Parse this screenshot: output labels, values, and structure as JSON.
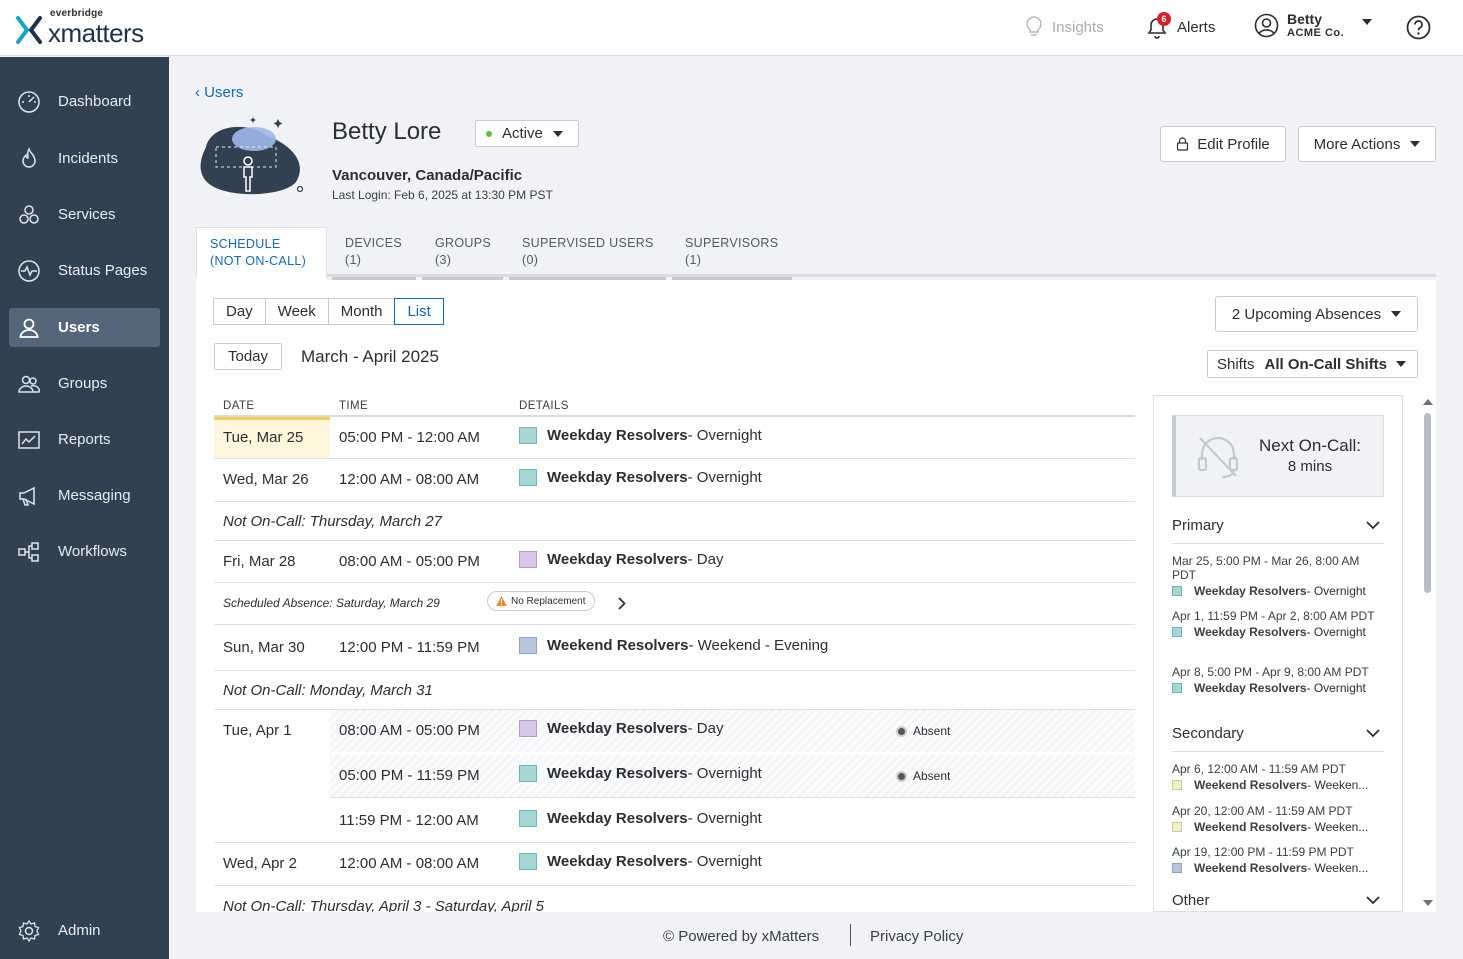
{
  "header": {
    "brand_sub": "everbridge",
    "brand_main": "xmatters",
    "insights": "Insights",
    "alerts": "Alerts",
    "alerts_count": "6",
    "user_name": "Betty",
    "user_org": "ACME Co."
  },
  "sidebar": {
    "items": [
      {
        "label": "Dashboard",
        "icon": "gauge-icon"
      },
      {
        "label": "Incidents",
        "icon": "flame-icon"
      },
      {
        "label": "Services",
        "icon": "services-icon"
      },
      {
        "label": "Status Pages",
        "icon": "pulse-icon"
      },
      {
        "label": "Users",
        "icon": "user-icon"
      },
      {
        "label": "Groups",
        "icon": "groups-icon"
      },
      {
        "label": "Reports",
        "icon": "chart-icon"
      },
      {
        "label": "Messaging",
        "icon": "megaphone-icon"
      },
      {
        "label": "Workflows",
        "icon": "workflow-icon"
      }
    ],
    "admin": "Admin",
    "collapse": "«"
  },
  "profile": {
    "back": "‹ Users",
    "name": "Betty Lore",
    "status": "Active",
    "location": "Vancouver, Canada/Pacific",
    "last_login": "Last Login: Feb 6, 2025 at 13:30 PM PST",
    "edit": "Edit Profile",
    "more": "More Actions"
  },
  "tabs": [
    {
      "l1": "SCHEDULE",
      "l2": "(NOT ON-CALL)"
    },
    {
      "l1": "DEVICES",
      "l2": "(1)"
    },
    {
      "l1": "GROUPS",
      "l2": "(3)"
    },
    {
      "l1": "SUPERVISED USERS",
      "l2": "(0)"
    },
    {
      "l1": "SUPERVISORS",
      "l2": "(1)"
    }
  ],
  "schedule": {
    "views": [
      "Day",
      "Week",
      "Month",
      "List"
    ],
    "absences": "2 Upcoming Absences",
    "today": "Today",
    "range": "March - April 2025",
    "shifts_label": "Shifts",
    "shifts_value": "All On-Call Shifts",
    "col_date": "DATE",
    "col_time": "TIME",
    "col_details": "DETAILS",
    "rows": {
      "r1": {
        "date": "Tue, Mar 25",
        "time": "05:00 PM - 12:00 AM",
        "group": "Weekday Resolvers",
        "shift": " - Overnight"
      },
      "r2": {
        "date": "Wed, Mar 26",
        "time": "12:00 AM - 08:00 AM",
        "group": "Weekday Resolvers",
        "shift": " - Overnight"
      },
      "n1": "Not On-Call: Thursday, March 27",
      "r3": {
        "date": "Fri, Mar 28",
        "time": "08:00 AM - 05:00 PM",
        "group": "Weekday Resolvers",
        "shift": " - Day"
      },
      "abs": "Scheduled Absence: Saturday, March 29",
      "norepl": "No Replacement",
      "r4": {
        "date": "Sun, Mar 30",
        "time": "12:00 PM - 11:59 PM",
        "group": "Weekend Resolvers",
        "shift": " - Weekend - Evening"
      },
      "n2": "Not On-Call: Monday, March 31",
      "r5": {
        "date": "Tue, Apr 1",
        "time": "08:00 AM - 05:00 PM",
        "group": "Weekday Resolvers",
        "shift": " - Day",
        "absent": "Absent"
      },
      "r6": {
        "time": "05:00 PM - 11:59 PM",
        "group": "Weekday Resolvers",
        "shift": " - Overnight",
        "absent": "Absent"
      },
      "r7": {
        "time": "11:59 PM - 12:00 AM",
        "group": "Weekday Resolvers",
        "shift": " - Overnight"
      },
      "r8": {
        "date": "Wed, Apr 2",
        "time": "12:00 AM - 08:00 AM",
        "group": "Weekday Resolvers",
        "shift": " - Overnight"
      },
      "n3": "Not On-Call: Thursday, April 3 - Saturday, April 5"
    }
  },
  "oncall": {
    "title": "Next On-Call:",
    "value": "8 mins",
    "primary": "Primary",
    "secondary": "Secondary",
    "other": "Other",
    "p1": {
      "time": "Mar 25, 5:00 PM - Mar 26, 8:00 AM PDT",
      "group": "Weekday Resolvers",
      "shift": " - Overnight"
    },
    "p2": {
      "time": "Apr 1, 11:59 PM - Apr 2, 8:00 AM PDT",
      "group": "Weekday Resolvers",
      "shift": " - Overnight"
    },
    "p3": {
      "time": "Apr 8, 5:00 PM - Apr 9, 8:00 AM PDT",
      "group": "Weekday Resolvers",
      "shift": " - Overnight"
    },
    "s1": {
      "time": "Apr 6, 12:00 AM - 11:59 AM PDT",
      "group": "Weekend Resolvers",
      "shift": " - Weeken..."
    },
    "s2": {
      "time": "Apr 20, 12:00 AM - 11:59 AM PDT",
      "group": "Weekend Resolvers",
      "shift": " - Weeken..."
    },
    "s3": {
      "time": "Apr 19, 12:00 PM - 11:59 PM PDT",
      "group": "Weekend Resolvers",
      "shift": " - Weeken..."
    }
  },
  "footer": {
    "powered": "© Powered by xMatters",
    "privacy": "Privacy Policy"
  },
  "colors": {
    "sidebar": "#324151",
    "accent": "#136ab6",
    "shift_day": "#d6c7e9",
    "shift_overnight": "#a9d6d4",
    "shift_weekend": "#b6c6dc"
  }
}
